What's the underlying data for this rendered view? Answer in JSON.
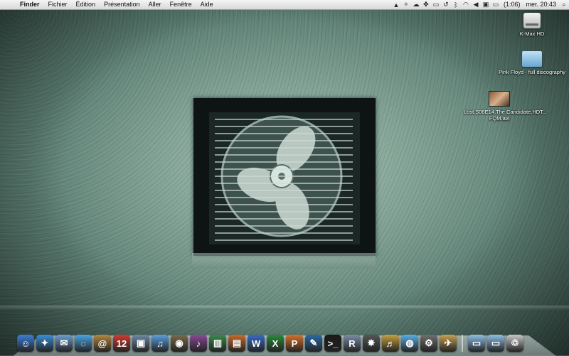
{
  "menubar": {
    "apple_icon": "apple-icon",
    "app_name": "Finder",
    "menus": [
      "Fichier",
      "Édition",
      "Présentation",
      "Aller",
      "Fenêtre",
      "Aide"
    ],
    "status": {
      "battery_text": "(1:06)",
      "clock": "mer. 20:43",
      "icons": [
        "hat-icon",
        "bird-icon",
        "cloud-icon",
        "paw-icon",
        "display-icon",
        "timemachine-icon",
        "bluetooth-icon",
        "wifi-icon",
        "volume-icon",
        "input-menu-icon",
        "battery-icon",
        "spotlight-icon"
      ]
    }
  },
  "desktop": {
    "icons": [
      {
        "name": "hard-drive-icon",
        "label": "K-Max HD"
      },
      {
        "name": "folder-icon",
        "label": "Pink Floyd - full discography"
      },
      {
        "name": "movie-file-icon",
        "label": "Lost.S06E14.The.Candidate.HDT...-FQM.avi"
      }
    ]
  },
  "dock": {
    "apps": [
      {
        "name": "finder-icon",
        "glyph": "☺",
        "color": "#3b7fd6"
      },
      {
        "name": "safari-icon",
        "glyph": "✦",
        "color": "#3a8fd8"
      },
      {
        "name": "mail-icon",
        "glyph": "✉",
        "color": "#6c9fd0"
      },
      {
        "name": "ichat-icon",
        "glyph": "◌",
        "color": "#4aa6e8"
      },
      {
        "name": "address-book-icon",
        "glyph": "@",
        "color": "#b4883c"
      },
      {
        "name": "ical-icon",
        "glyph": "12",
        "color": "#d33b2f"
      },
      {
        "name": "iphoto-icon",
        "glyph": "▣",
        "color": "#6b8aa8"
      },
      {
        "name": "itunes-icon",
        "glyph": "♫",
        "color": "#5aa0e0"
      },
      {
        "name": "aperture-icon",
        "glyph": "◉",
        "color": "#7b6a4a"
      },
      {
        "name": "guitar-icon",
        "glyph": "♪",
        "color": "#8b4a9a"
      },
      {
        "name": "numbers-icon",
        "glyph": "▥",
        "color": "#3a8a4a"
      },
      {
        "name": "keynote-icon",
        "glyph": "▤",
        "color": "#c86a2a"
      },
      {
        "name": "word-icon",
        "glyph": "W",
        "color": "#3a6ac8"
      },
      {
        "name": "excel-icon",
        "glyph": "X",
        "color": "#2a8a3a"
      },
      {
        "name": "powerpoint-icon",
        "glyph": "P",
        "color": "#d8702a"
      },
      {
        "name": "xcode-icon",
        "glyph": "✎",
        "color": "#2a6aa8"
      },
      {
        "name": "terminal-icon",
        "glyph": ">_",
        "color": "#1a1a1a"
      },
      {
        "name": "r-icon",
        "glyph": "R",
        "color": "#7a8ea8"
      },
      {
        "name": "inkscape-icon",
        "glyph": "✸",
        "color": "#555555"
      },
      {
        "name": "garageband-icon",
        "glyph": "♬",
        "color": "#c8a040"
      },
      {
        "name": "adium-icon",
        "glyph": "◍",
        "color": "#58b0e8"
      },
      {
        "name": "system-preferences-icon",
        "glyph": "⚙",
        "color": "#707070"
      },
      {
        "name": "transmission-icon",
        "glyph": "✈",
        "color": "#c8a050"
      }
    ],
    "stacks": [
      {
        "name": "applications-stack-icon",
        "glyph": "▭",
        "color": "#8ec0e8"
      },
      {
        "name": "downloads-stack-icon",
        "glyph": "▭",
        "color": "#8ec0e8"
      },
      {
        "name": "trash-icon",
        "glyph": "♲",
        "color": "#c8c8c8"
      }
    ]
  }
}
